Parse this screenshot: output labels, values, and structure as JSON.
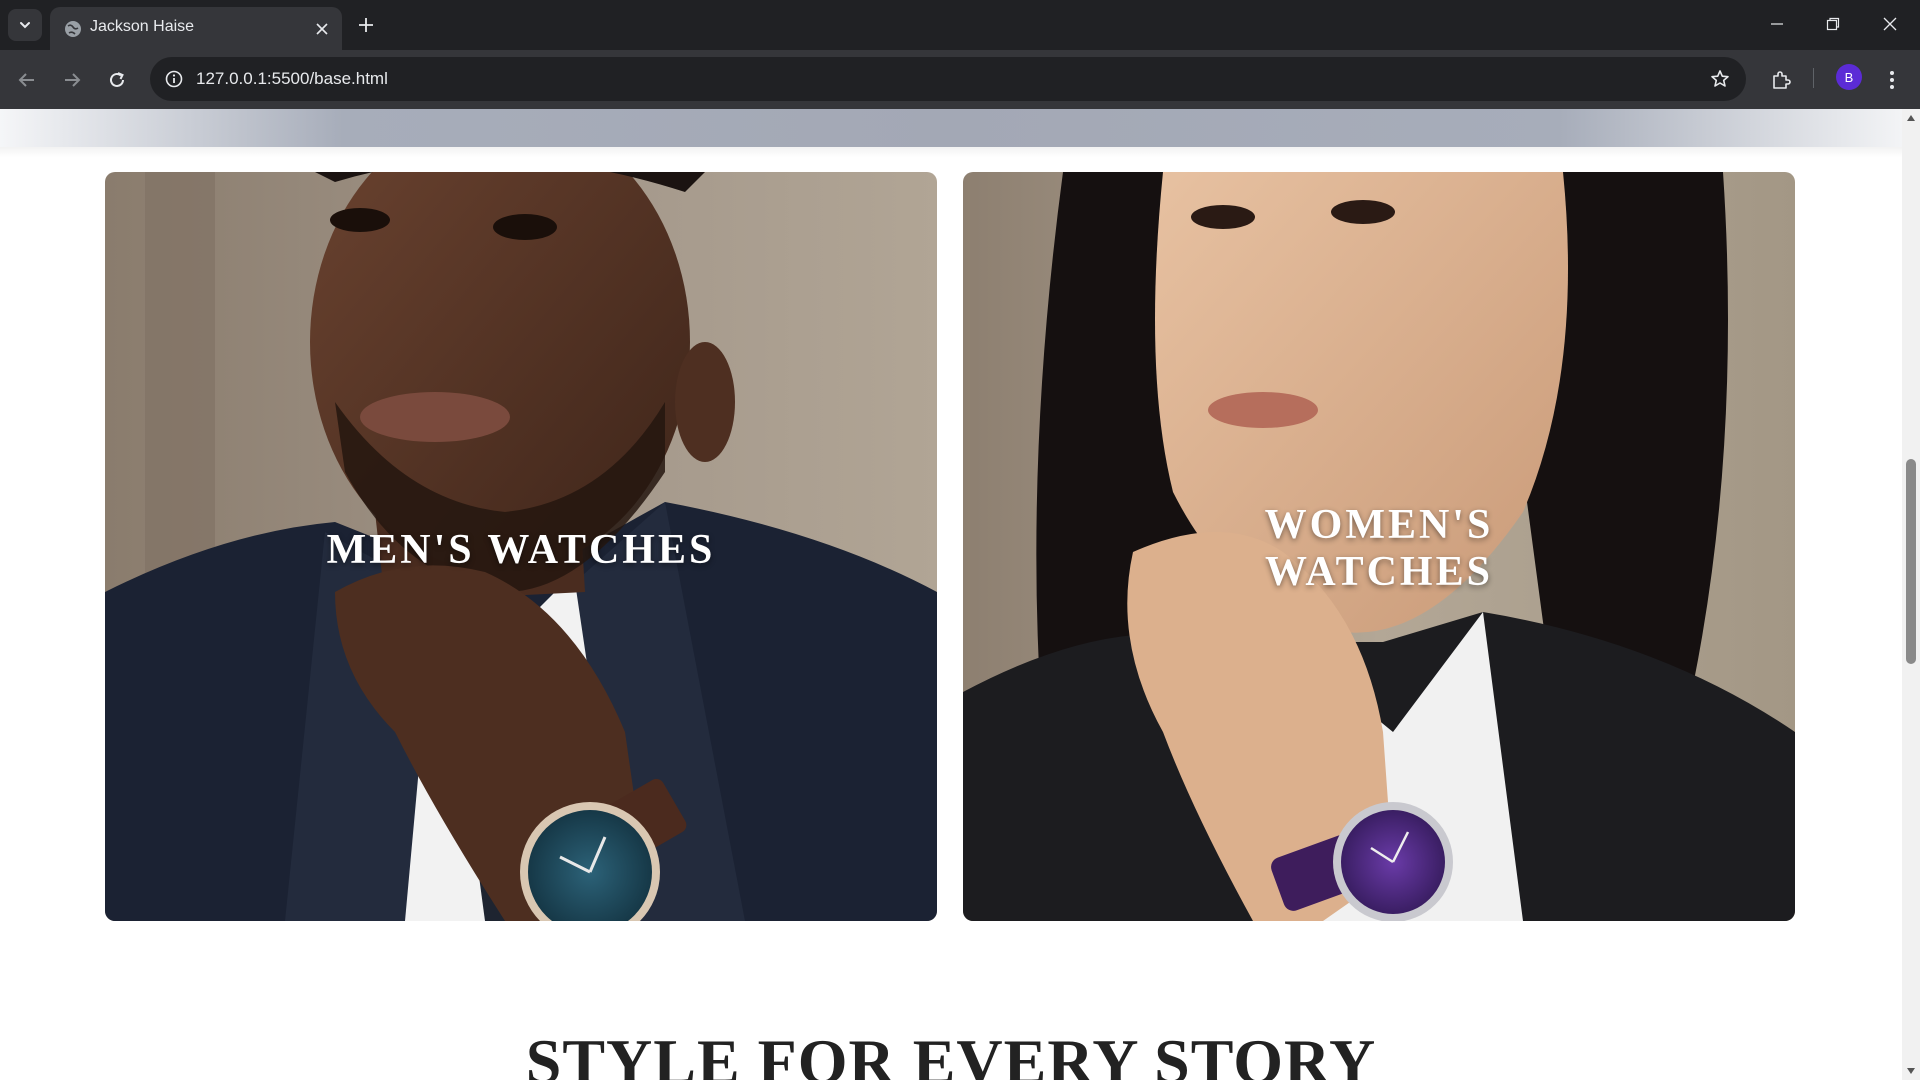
{
  "browser": {
    "tab_title": "Jackson Haise",
    "url": "127.0.0.1:5500/base.html",
    "profile_initial": "B"
  },
  "page": {
    "cards": [
      {
        "label_lines": [
          "MEN'S WATCHES"
        ],
        "watch_dial_color": "#1f4a5e"
      },
      {
        "label_lines": [
          "WOMEN'S",
          "WATCHES"
        ],
        "watch_dial_color": "#4a2a7a"
      }
    ],
    "section_title": "STYLE FOR EVERY STORY"
  },
  "colors": {
    "chrome_dark": "#202124",
    "chrome_toolbar": "#35363a",
    "avatar": "#5b2bd6",
    "title_text": "#222222"
  },
  "icons": [
    "tab-search-icon",
    "globe-icon",
    "close-icon",
    "plus-icon",
    "minimize-icon",
    "restore-icon",
    "window-close-icon",
    "back-icon",
    "forward-icon",
    "reload-icon",
    "site-info-icon",
    "star-icon",
    "extensions-icon",
    "more-icon"
  ]
}
